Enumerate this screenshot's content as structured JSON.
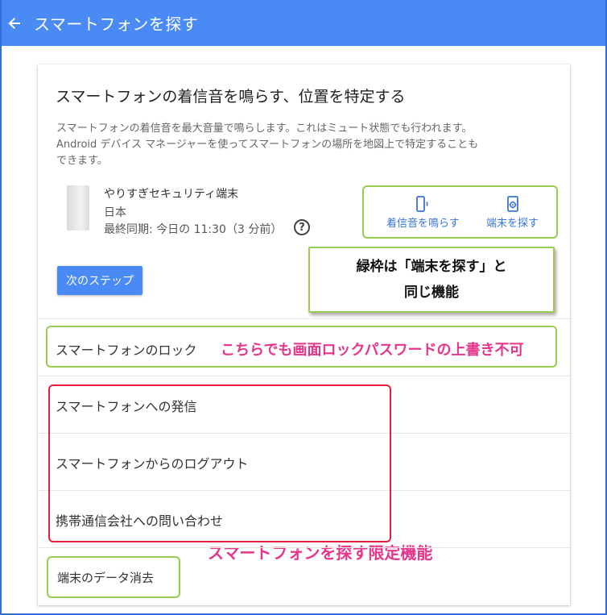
{
  "header": {
    "title": "スマートフォンを探す"
  },
  "card": {
    "heading": "スマートフォンの着信音を鳴らす、位置を特定する",
    "description_line1": "スマートフォンの着信音を最大音量で鳴らします。これはミュート状態でも行われます。",
    "description_line2": "Android デバイス マネージャーを使ってスマートフォンの場所を地図上で特定することも",
    "description_line3": "できます。",
    "device": {
      "name": "やりすぎセキュリティ端末",
      "country": "日本",
      "last_sync": "最終同期: 今日の 11:30（3 分前）"
    },
    "actions": {
      "ring_label": "着信音を鳴らす",
      "find_label": "端末を探す"
    },
    "next_step_label": "次のステップ"
  },
  "rows": [
    {
      "label": "スマートフォンのロック"
    },
    {
      "label": "スマートフォンへの発信"
    },
    {
      "label": "スマートフォンからのログアウト"
    },
    {
      "label": "携帯通信会社への問い合わせ"
    },
    {
      "label": "端末のデータ消去"
    }
  ],
  "annotations": {
    "green_callout_line1": "緑枠は「端末を探す」と",
    "green_callout_line2": "同じ機能",
    "lock_note": "こちらでも画面ロックパスワードの上書き不可",
    "limited_note": "スマートフォンを探す限定機能"
  },
  "colors": {
    "header_bg": "#4a8af4",
    "link_blue": "#3a75d9",
    "annotation_green": "#9bcc4f",
    "annotation_red": "#e3213f",
    "annotation_pink": "#e6358a"
  }
}
